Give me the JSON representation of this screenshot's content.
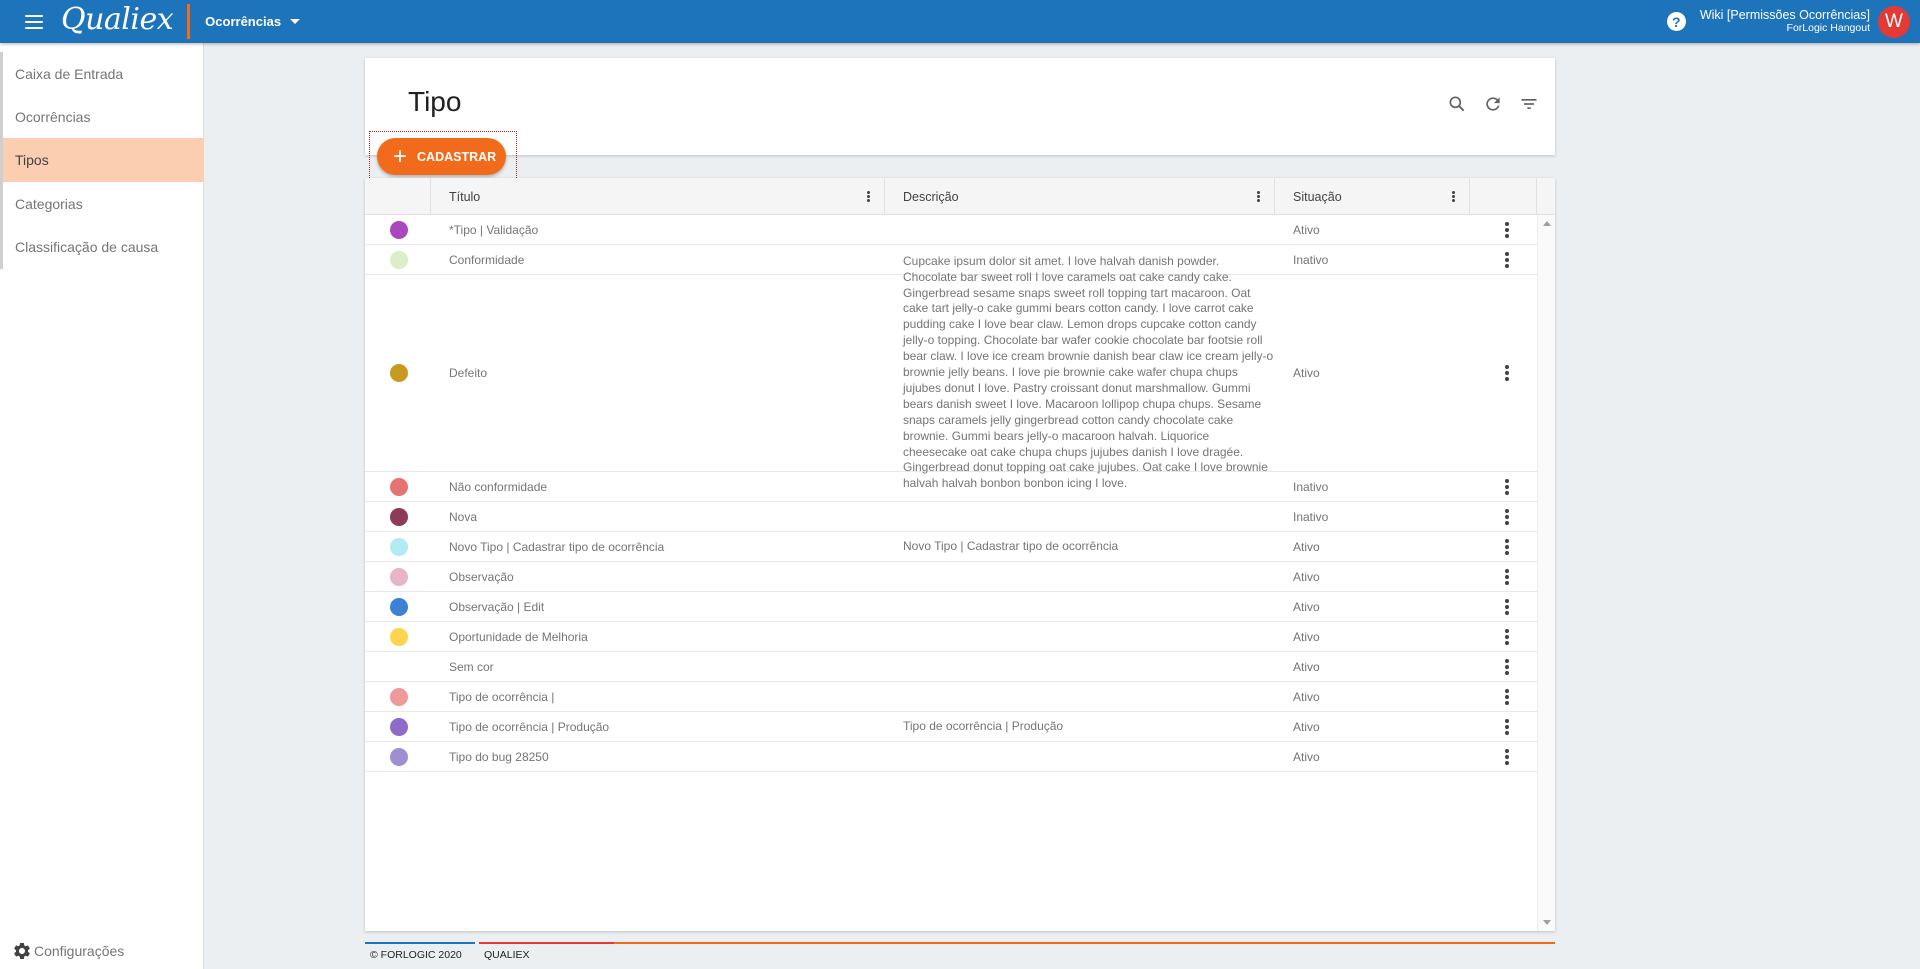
{
  "header": {
    "logo": "Qualiex",
    "module": "Ocorrências",
    "user_name": "Wiki [Permissões Ocorrências]",
    "user_company": "ForLogic Hangout",
    "avatar_initial": "W",
    "help": "?"
  },
  "sidebar": {
    "items": [
      {
        "label": "Caixa de Entrada"
      },
      {
        "label": "Ocorrências"
      },
      {
        "label": "Tipos"
      },
      {
        "label": "Categorias"
      },
      {
        "label": "Classificação de causa"
      }
    ],
    "settings_label": "Configurações"
  },
  "page": {
    "title": "Tipo",
    "add_label": "CADASTRAR",
    "add_icon": "+"
  },
  "table": {
    "columns": {
      "title": "Título",
      "description": "Descrição",
      "status": "Situação"
    },
    "rows": [
      {
        "color": "#ab47bc",
        "title": "*Tipo | Validação",
        "description": "",
        "status": "Ativo"
      },
      {
        "color": "#dcedc8",
        "title": "Conformidade",
        "description": "",
        "status": "Inativo"
      },
      {
        "color": "#c99a22",
        "title": "Defeito",
        "description": "Cupcake ipsum dolor sit amet. I love halvah danish powder. Chocolate bar sweet roll I love caramels oat cake candy cake. Gingerbread sesame snaps sweet roll topping tart macaroon. Oat cake tart jelly-o cake gummi bears cotton candy. I love carrot cake pudding cake I love bear claw. Lemon drops cupcake cotton candy jelly-o topping. Chocolate bar wafer cookie chocolate bar footsie roll bear claw. I love ice cream brownie danish bear claw ice cream jelly-o brownie jelly beans. I love pie brownie cake wafer chupa chups jujubes donut I love. Pastry croissant donut marshmallow. Gummi bears danish sweet I love. Macaroon lollipop chupa chups. Sesame snaps caramels jelly gingerbread cotton candy chocolate cake brownie. Gummi bears jelly-o macaroon halvah. Liquorice cheesecake oat cake chupa chups jujubes danish I love dragée. Gingerbread donut topping oat cake jujubes. Oat cake I love brownie halvah halvah bonbon bonbon icing I love.",
        "status": "Ativo"
      },
      {
        "color": "#e57373",
        "title": "Não conformidade",
        "description": "",
        "status": "Inativo"
      },
      {
        "color": "#8e3a59",
        "title": "Nova",
        "description": "",
        "status": "Inativo"
      },
      {
        "color": "#b2ebf2",
        "title": "Novo Tipo | Cadastrar tipo de ocorrência",
        "description": "Novo Tipo | Cadastrar tipo de ocorrência",
        "status": "Ativo"
      },
      {
        "color": "#e8b4c8",
        "title": "Observação",
        "description": "",
        "status": "Ativo"
      },
      {
        "color": "#3b82d6",
        "title": "Observação | Edit",
        "description": "",
        "status": "Ativo"
      },
      {
        "color": "#ffd54f",
        "title": "Oportunidade de Melhoria",
        "description": "",
        "status": "Ativo"
      },
      {
        "color": "",
        "title": "Sem cor",
        "description": "",
        "status": "Ativo"
      },
      {
        "color": "#ef9a9a",
        "title": "Tipo de ocorrência |",
        "description": "",
        "status": "Ativo"
      },
      {
        "color": "#8e6bc9",
        "title": "Tipo de ocorrência | Produção",
        "description": "Tipo de ocorrência | Produção",
        "status": "Ativo"
      },
      {
        "color": "#9f8fd1",
        "title": "Tipo do bug 28250",
        "description": "",
        "status": "Ativo"
      }
    ]
  },
  "footer": {
    "copyright": "© FORLOGIC 2020",
    "brand": "QUALIEX"
  }
}
